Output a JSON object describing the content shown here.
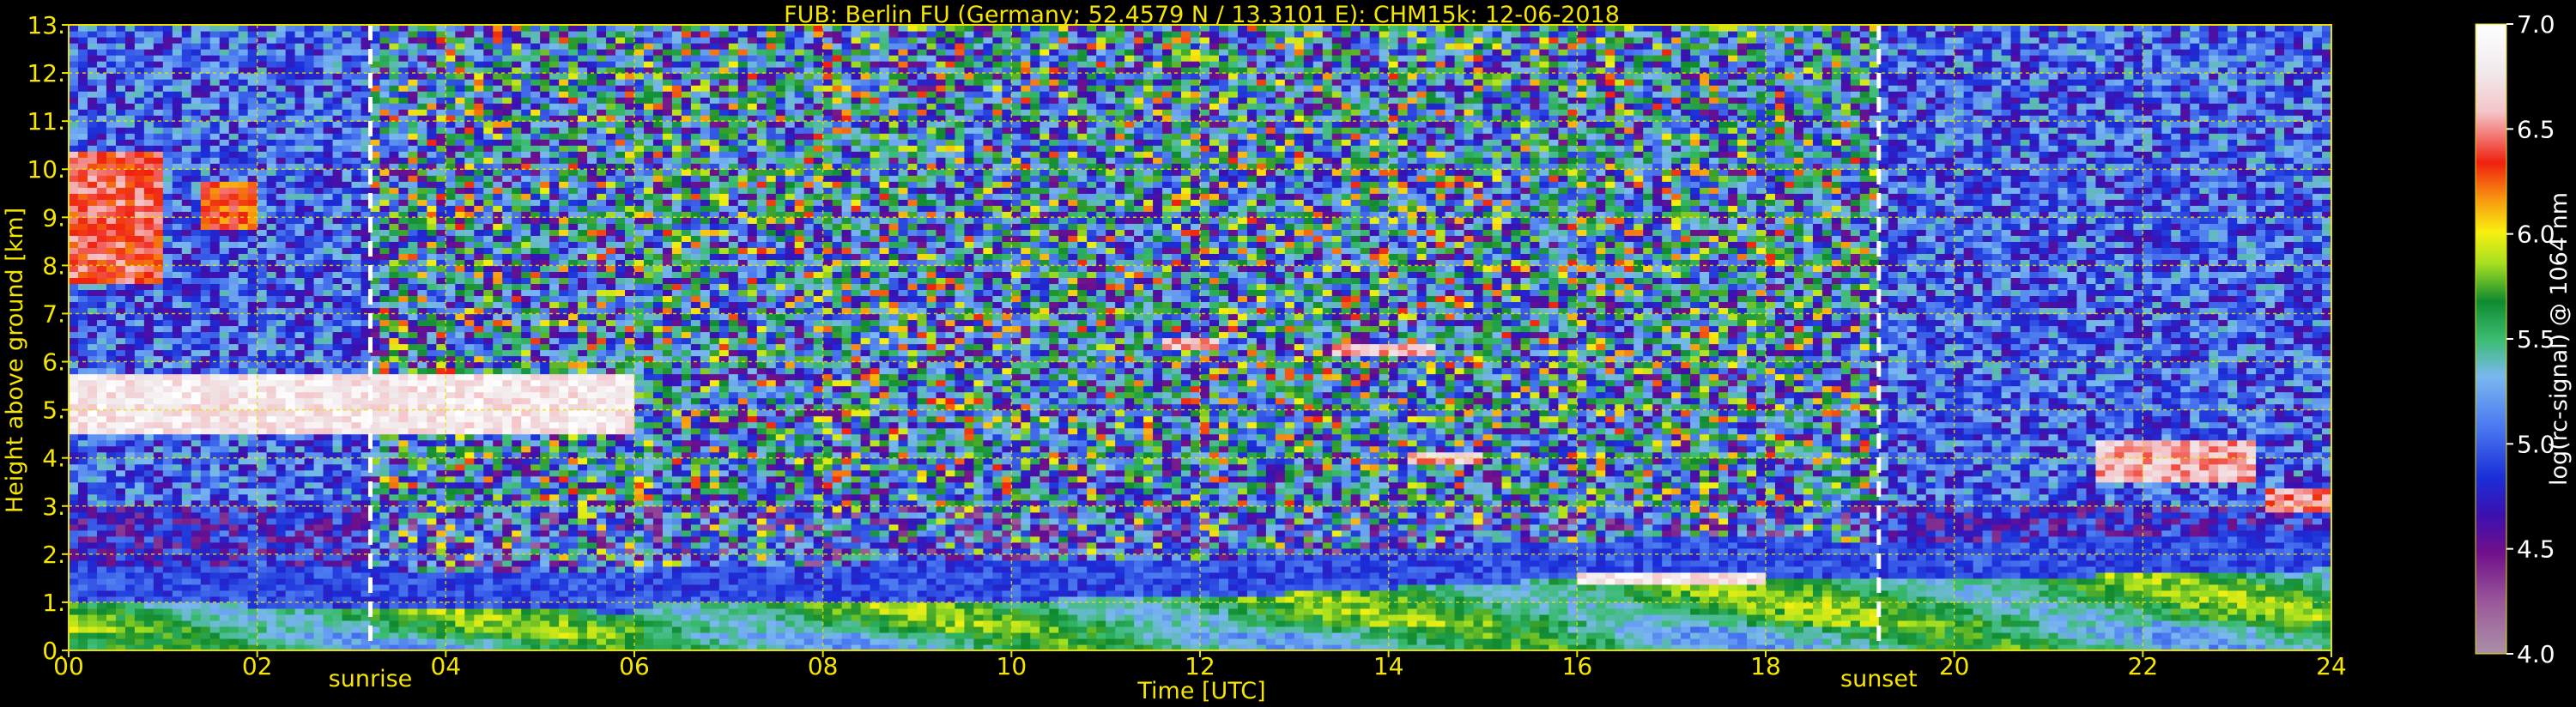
{
  "chart_data": {
    "type": "heatmap",
    "title": "FUB: Berlin FU (Germany; 52.4579 N / 13.3101 E):    CHM15k: 12-06-2018",
    "xlabel": "Time [UTC]",
    "ylabel": "Height above ground [km]",
    "colorbar_label": "log(rc-signal) @ 1064 nm",
    "xlim": [
      0,
      24
    ],
    "ylim": [
      0,
      13
    ],
    "clim": [
      4.0,
      7.0
    ],
    "x_ticks": [
      "00",
      "02",
      "04",
      "06",
      "08",
      "10",
      "12",
      "14",
      "16",
      "18",
      "20",
      "22",
      "24"
    ],
    "x_tick_values": [
      0,
      2,
      4,
      6,
      8,
      10,
      12,
      14,
      16,
      18,
      20,
      22,
      24
    ],
    "y_ticks": [
      "0.",
      "1.",
      "2.",
      "3.",
      "4.",
      "5.",
      "6.",
      "7.",
      "8.",
      "9.",
      "10.",
      "11.",
      "12.",
      "13."
    ],
    "y_tick_values": [
      0,
      1,
      2,
      3,
      4,
      5,
      6,
      7,
      8,
      9,
      10,
      11,
      12,
      13
    ],
    "colorbar_ticks": [
      "4.0",
      "4.5",
      "5.0",
      "5.5",
      "6.0",
      "6.5",
      "7.0"
    ],
    "colorbar_tick_values": [
      4.0,
      4.5,
      5.0,
      5.5,
      6.0,
      6.5,
      7.0
    ],
    "grid": true,
    "markers": [
      {
        "label": "sunrise",
        "x": 3.2
      },
      {
        "label": "sunset",
        "x": 19.2
      }
    ],
    "features": {
      "boundary_layer_top": [
        [
          0,
          1.0
        ],
        [
          3,
          0.9
        ],
        [
          6,
          0.8
        ],
        [
          6.2,
          0.95
        ],
        [
          8,
          1.0
        ],
        [
          10,
          1.05
        ],
        [
          12,
          1.1
        ],
        [
          14,
          1.3
        ],
        [
          15.5,
          1.45
        ],
        [
          17,
          1.55
        ],
        [
          18,
          1.55
        ],
        [
          19,
          1.5
        ],
        [
          20,
          1.45
        ],
        [
          22,
          1.6
        ],
        [
          24,
          1.7
        ]
      ],
      "cloud_layers": [
        {
          "x_start": 0.0,
          "x_end": 6.0,
          "y_bottom": 4.5,
          "y_top": 5.8,
          "value": 7.0
        },
        {
          "x_start": 0.0,
          "x_end": 1.0,
          "y_bottom": 7.6,
          "y_top": 10.4,
          "value": 6.6
        },
        {
          "x_start": 1.4,
          "x_end": 2.0,
          "y_bottom": 8.8,
          "y_top": 9.8,
          "value": 6.5
        },
        {
          "x_start": 11.6,
          "x_end": 12.2,
          "y_bottom": 6.3,
          "y_top": 6.5,
          "value": 6.8
        },
        {
          "x_start": 13.4,
          "x_end": 14.5,
          "y_bottom": 6.1,
          "y_top": 6.4,
          "value": 6.8
        },
        {
          "x_start": 14.2,
          "x_end": 15.0,
          "y_bottom": 3.9,
          "y_top": 4.1,
          "value": 6.8
        },
        {
          "x_start": 21.5,
          "x_end": 23.2,
          "y_bottom": 3.5,
          "y_top": 4.4,
          "value": 6.8
        },
        {
          "x_start": 23.3,
          "x_end": 24.0,
          "y_bottom": 2.9,
          "y_top": 3.4,
          "value": 6.7
        },
        {
          "x_start": 16.0,
          "x_end": 18.0,
          "y_bottom": 1.35,
          "y_top": 1.6,
          "value": 7.0
        }
      ]
    }
  },
  "colors": {
    "text": "#f5e500",
    "grid": "#e8e000",
    "background": "#000000"
  }
}
